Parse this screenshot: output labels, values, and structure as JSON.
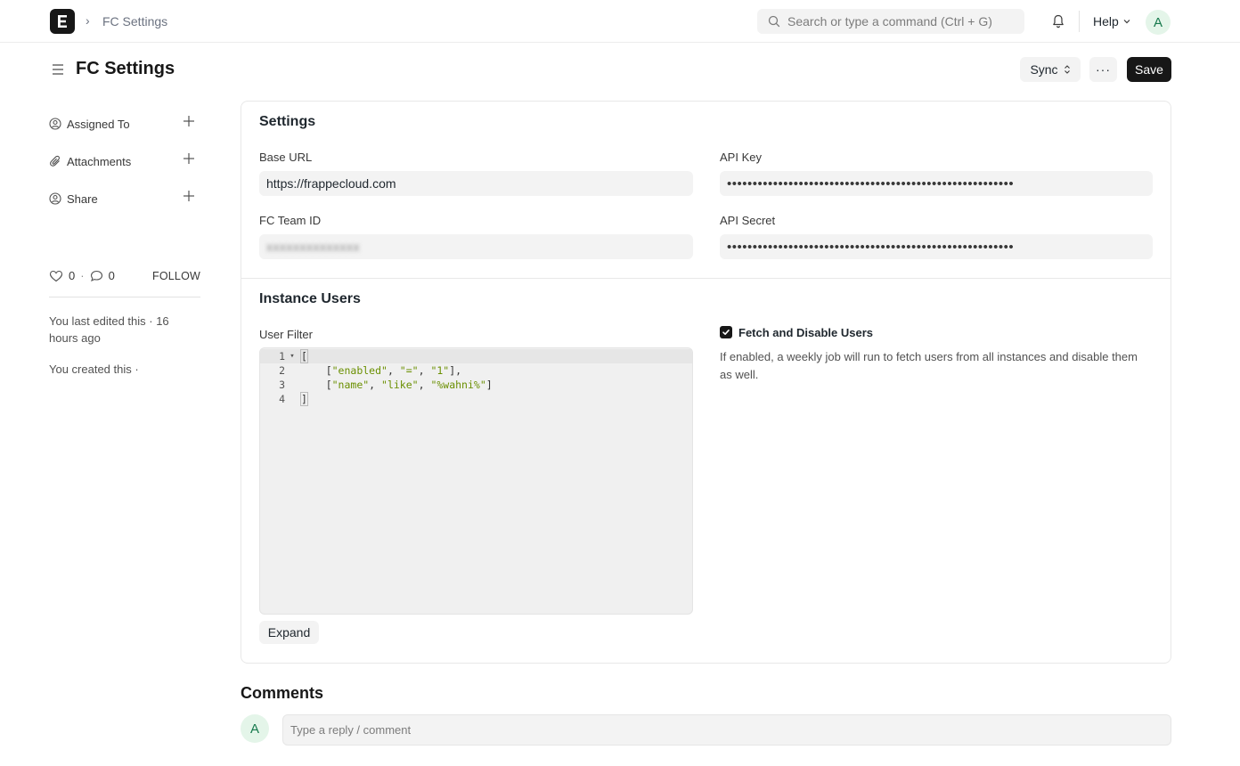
{
  "navbar": {
    "logo_letter": "E",
    "breadcrumb_sep": "›",
    "breadcrumb": "FC Settings",
    "search_placeholder": "Search or type a command (Ctrl + G)",
    "help_label": "Help",
    "avatar_initial": "A"
  },
  "page": {
    "title": "FC Settings",
    "sync_label": "Sync",
    "more_label": "···",
    "save_label": "Save"
  },
  "sidebar": {
    "items": [
      {
        "label": "Assigned To",
        "icon": "assign-user-icon"
      },
      {
        "label": "Attachments",
        "icon": "paperclip-icon"
      },
      {
        "label": "Share",
        "icon": "share-user-icon"
      }
    ],
    "likes": "0",
    "comments": "0",
    "dot": "·",
    "follow_label": "FOLLOW",
    "last_edited": "You last edited this · 16 hours ago",
    "created": "You created this ·"
  },
  "form": {
    "settings_section": "Settings",
    "base_url_label": "Base URL",
    "base_url_value": "https://frappecloud.com",
    "api_key_label": "API Key",
    "api_key_value": "••••••••••••••••••••••••••••••••••••••••••••••••••••••••",
    "team_id_label": "FC Team ID",
    "team_id_value": "xxxxxxxxxxxxxx",
    "api_secret_label": "API Secret",
    "api_secret_value": "••••••••••••••••••••••••••••••••••••••••••••••••••••••••",
    "users_section": "Instance Users",
    "user_filter_label": "User Filter",
    "code_lines": [
      {
        "num": "1",
        "text": "["
      },
      {
        "num": "2",
        "text": "    [\"enabled\", \"=\", \"1\"],"
      },
      {
        "num": "3",
        "text": "    [\"name\", \"like\", \"%wahni%\"]"
      },
      {
        "num": "4",
        "text": "]"
      }
    ],
    "expand_label": "Expand",
    "fetch_disable_label": "Fetch and Disable Users",
    "fetch_disable_checked": true,
    "fetch_disable_desc": "If enabled, a weekly job will run to fetch users from all instances and disable them as well."
  },
  "comments": {
    "heading": "Comments",
    "avatar_initial": "A",
    "placeholder": "Type a reply / comment"
  },
  "colors": {
    "primary_dark": "#171717",
    "input_bg": "#f3f3f3",
    "avatar_bg": "#e4f5e9",
    "avatar_fg": "#16794c",
    "code_string": "#6a8f00"
  }
}
